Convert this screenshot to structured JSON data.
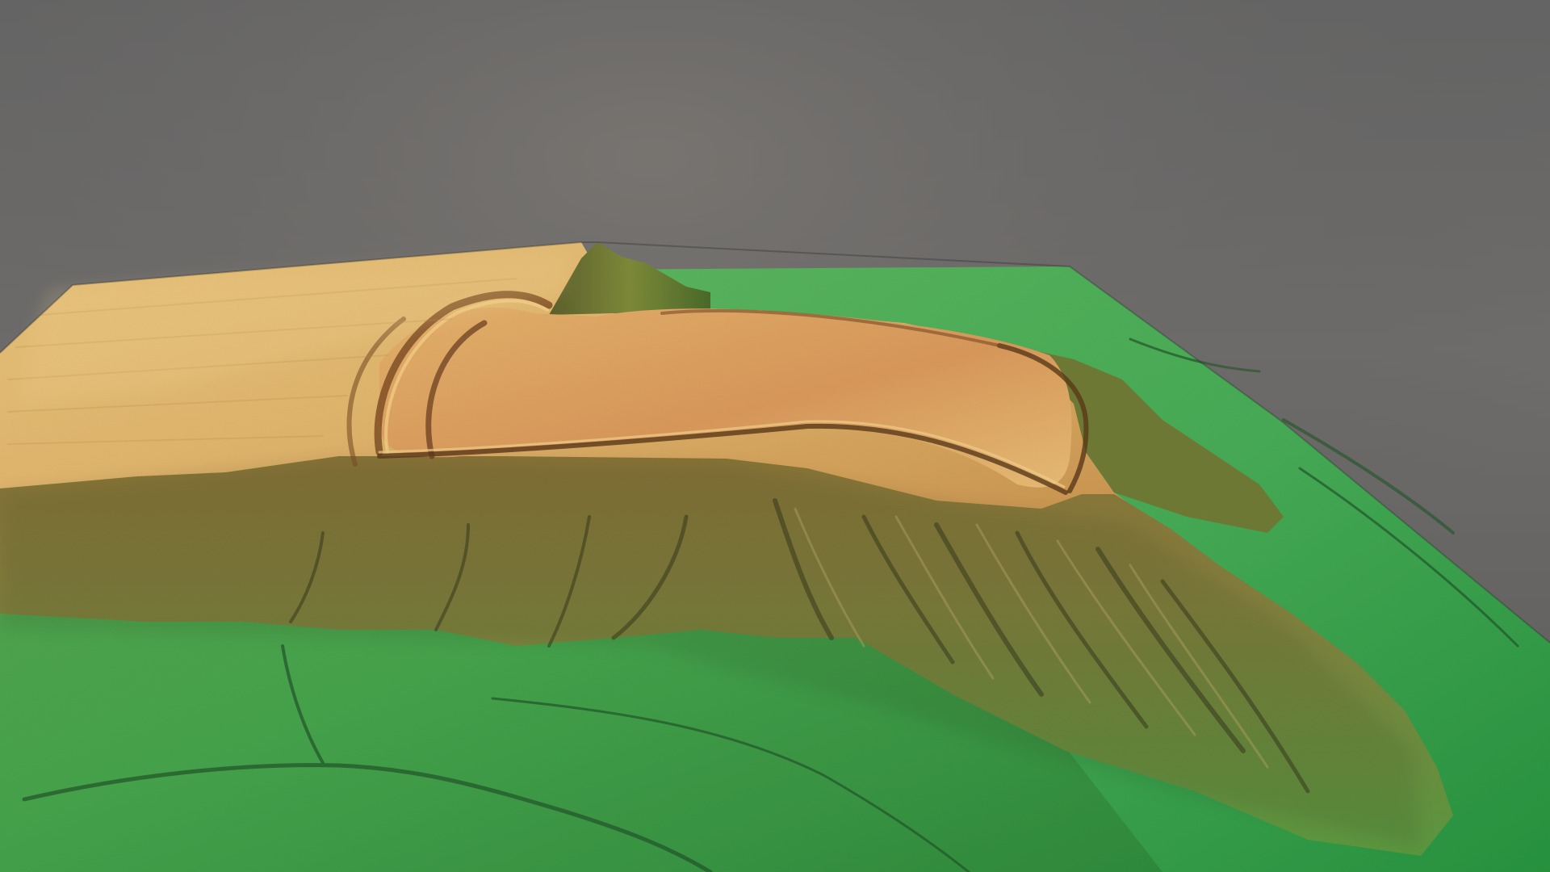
{
  "scene": {
    "subject": "terrain-model-render",
    "palette": {
      "background_top": "#626262",
      "background_mid": "#6c6a69",
      "background_bottom": "#5a5a5a",
      "plateau_light": "#e8bf72",
      "plateau_mid": "#d6a25e",
      "plateau_dark": "#b07a3f",
      "slope_brown": "#7b6a34",
      "slope_olive": "#8c8c43",
      "lowland_green": "#3f9c43",
      "lowland_bright": "#55b85b",
      "lowland_dark": "#2f7b37",
      "ridge_dark": "#2f2f20"
    }
  }
}
